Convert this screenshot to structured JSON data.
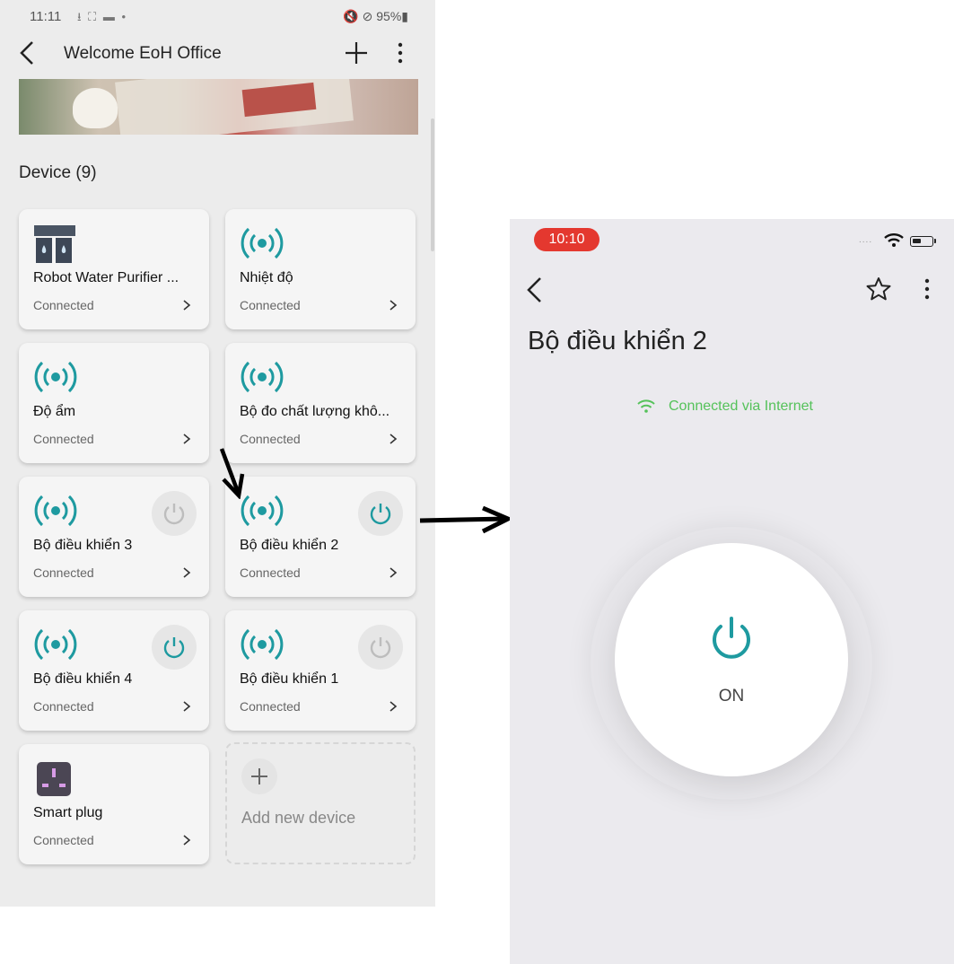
{
  "left_screen": {
    "statusbar": {
      "time": "11:11",
      "left_icons": "⭳ ⛶ ▬ •",
      "right_icons": "🔇 ⊘ 95%▮"
    },
    "appbar": {
      "title": "Welcome EoH Office"
    },
    "section_title": "Device (9)",
    "devices": [
      {
        "name": "Robot Water Purifier ...",
        "status": "Connected",
        "icon": "water-purifier-icon"
      },
      {
        "name": "Nhiệt độ",
        "status": "Connected",
        "icon": "signal-broadcast-icon"
      },
      {
        "name": "Độ ẩm",
        "status": "Connected",
        "icon": "signal-broadcast-icon"
      },
      {
        "name": "Bộ đo chất lượng khô...",
        "status": "Connected",
        "icon": "signal-broadcast-icon"
      },
      {
        "name": "Bộ điều khiển 3",
        "status": "Connected",
        "icon": "signal-broadcast-icon",
        "power": "off"
      },
      {
        "name": "Bộ điều khiển 2",
        "status": "Connected",
        "icon": "signal-broadcast-icon",
        "power": "on"
      },
      {
        "name": "Bộ điều khiển 4",
        "status": "Connected",
        "icon": "signal-broadcast-icon",
        "power": "on"
      },
      {
        "name": "Bộ điều khiển 1",
        "status": "Connected",
        "icon": "signal-broadcast-icon",
        "power": "off"
      },
      {
        "name": "Smart plug",
        "status": "Connected",
        "icon": "smart-plug-icon"
      }
    ],
    "add_device_label": "Add new device"
  },
  "right_screen": {
    "time": "10:10",
    "title": "Bộ điều khiển 2",
    "connection": "Connected via Internet",
    "power_state": "ON"
  },
  "colors": {
    "accent_teal": "#1e9aa0",
    "connected_green": "#55c25a",
    "time_pill_red": "#e4382f"
  }
}
